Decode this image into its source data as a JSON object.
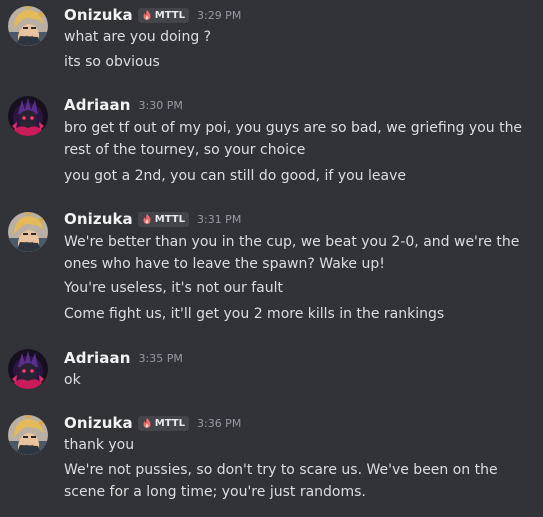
{
  "colors": {
    "background": "#313338",
    "username": "#f2f3f5",
    "message_text": "#dbdee1",
    "timestamp": "#949ba4",
    "tag_background": "#43454b",
    "tag_icon": "#f26b6b"
  },
  "groups": [
    {
      "author": "Onizuka",
      "avatar_icon": "anime-character-avatar-icon",
      "tag": {
        "icon": "flame-icon",
        "label": "MTTL"
      },
      "timestamp": "3:29 PM",
      "messages": [
        "what are you doing ?",
        "its so obvious"
      ]
    },
    {
      "author": "Adriaan",
      "avatar_icon": "dark-character-avatar-icon",
      "tag": null,
      "timestamp": "3:30 PM",
      "messages": [
        "bro get tf out of my poi, you guys are so bad, we griefing you the rest of the tourney, so your choice",
        "you got a 2nd, you can still do good, if you leave"
      ]
    },
    {
      "author": "Onizuka",
      "avatar_icon": "anime-character-avatar-icon",
      "tag": {
        "icon": "flame-icon",
        "label": "MTTL"
      },
      "timestamp": "3:31 PM",
      "messages": [
        "We're better than you in the cup, we beat you 2-0, and we're the ones who have to leave the spawn? Wake up!",
        "You're useless, it's not our fault",
        "Come fight us, it'll get you 2 more kills in the rankings"
      ]
    },
    {
      "author": "Adriaan",
      "avatar_icon": "dark-character-avatar-icon",
      "tag": null,
      "timestamp": "3:35 PM",
      "messages": [
        "ok"
      ]
    },
    {
      "author": "Onizuka",
      "avatar_icon": "anime-character-avatar-icon",
      "tag": {
        "icon": "flame-icon",
        "label": "MTTL"
      },
      "timestamp": "3:36 PM",
      "messages": [
        "thank you",
        "We're not pussies, so don't try to scare us. We've been on the scene for a long time; you're just randoms."
      ]
    }
  ]
}
